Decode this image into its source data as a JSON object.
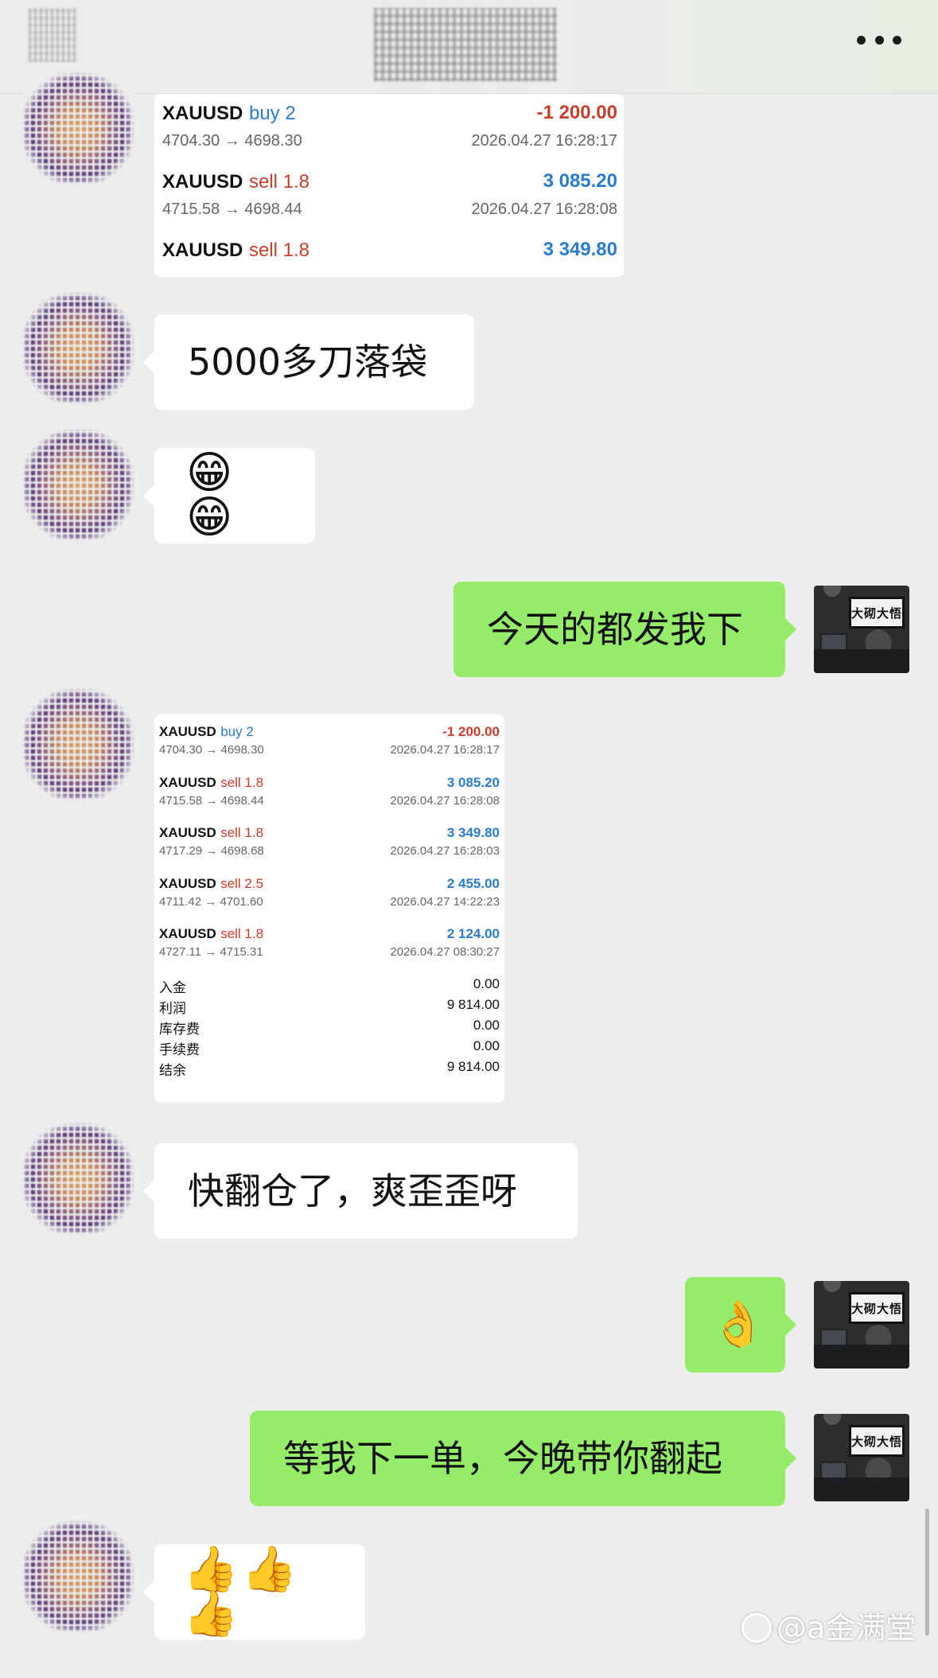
{
  "header": {
    "more_icon": "more-horizontal-icon"
  },
  "card1": {
    "trades": [
      {
        "symbol": "XAUUSD",
        "side": "buy 2",
        "side_type": "buy",
        "prices": "4704.30 → 4698.30",
        "profit": "-1 200.00",
        "time": "2026.04.27 16:28:17"
      },
      {
        "symbol": "XAUUSD",
        "side": "sell 1.8",
        "side_type": "sell",
        "prices": "4715.58 → 4698.44",
        "profit": "3 085.20",
        "time": "2026.04.27 16:28:08"
      },
      {
        "symbol": "XAUUSD",
        "side": "sell 1.8",
        "side_type": "sell",
        "prices": "",
        "profit": "3 349.80",
        "time": ""
      }
    ]
  },
  "messages": {
    "m1": "5000多刀落袋",
    "m2": "😁😁",
    "m3": "今天的都发我下",
    "m5": "快翻仓了，爽歪歪呀",
    "m6": "👌",
    "m7": "等我下一单，今晚带你翻起",
    "m8": "👍👍👍"
  },
  "card2": {
    "trades": [
      {
        "symbol": "XAUUSD",
        "side": "buy 2",
        "side_type": "buy",
        "prices": "4704.30 → 4698.30",
        "profit": "-1 200.00",
        "time": "2026.04.27 16:28:17"
      },
      {
        "symbol": "XAUUSD",
        "side": "sell 1.8",
        "side_type": "sell",
        "prices": "4715.58 → 4698.44",
        "profit": "3 085.20",
        "time": "2026.04.27 16:28:08"
      },
      {
        "symbol": "XAUUSD",
        "side": "sell 1.8",
        "side_type": "sell",
        "prices": "4717.29 → 4698.68",
        "profit": "3 349.80",
        "time": "2026.04.27 16:28:03"
      },
      {
        "symbol": "XAUUSD",
        "side": "sell 2.5",
        "side_type": "sell",
        "prices": "4711.42 → 4701.60",
        "profit": "2 455.00",
        "time": "2026.04.27 14:22:23"
      },
      {
        "symbol": "XAUUSD",
        "side": "sell 1.8",
        "side_type": "sell",
        "prices": "4727.11 → 4715.31",
        "profit": "2 124.00",
        "time": "2026.04.27 08:30:27"
      }
    ],
    "summary": [
      {
        "label": "入金",
        "value": "0.00"
      },
      {
        "label": "利润",
        "value": "9 814.00"
      },
      {
        "label": "库存费",
        "value": "0.00"
      },
      {
        "label": "手续费",
        "value": "0.00"
      },
      {
        "label": "结余",
        "value": "9 814.00"
      }
    ]
  },
  "my_avatar": {
    "sign_text": "大砌大悟"
  },
  "watermark": {
    "text": "@a金满堂"
  },
  "colors": {
    "background": "#ededed",
    "outgoing_bubble": "#95ec69",
    "incoming_bubble": "#ffffff",
    "loss_red": "#cc3c2a",
    "profit_blue": "#2a7bd2"
  }
}
